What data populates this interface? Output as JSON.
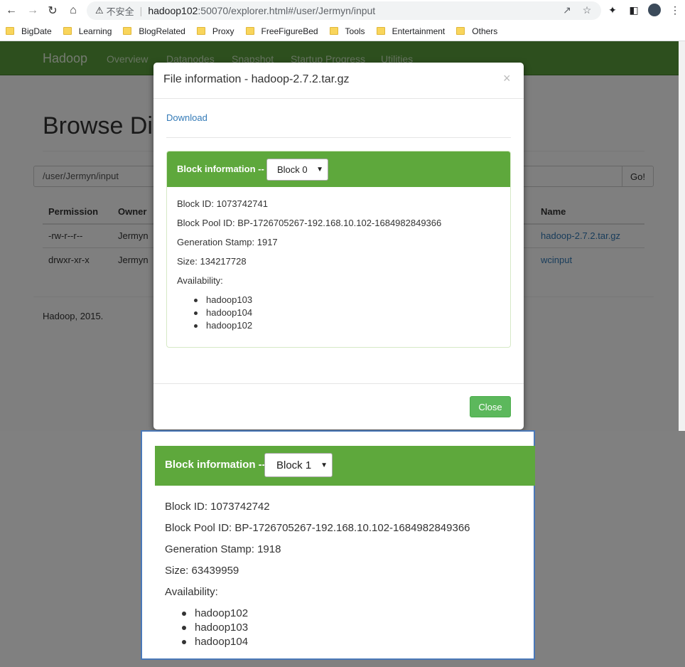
{
  "browser": {
    "warning_label": "不安全",
    "url_host": "hadoop102",
    "url_path": ":50070/explorer.html#/user/Jermyn/input",
    "bookmarks": [
      "BigDate",
      "Learning",
      "BlogRelated",
      "Proxy",
      "FreeFigureBed",
      "Tools",
      "Entertainment",
      "Others"
    ]
  },
  "navbar": {
    "brand": "Hadoop",
    "links": [
      "Overview",
      "Datanodes",
      "Snapshot",
      "Startup Progress",
      "Utilities"
    ]
  },
  "page": {
    "title": "Browse Directory",
    "path_value": "/user/Jermyn/input",
    "go_label": "Go!",
    "headers": [
      "Permission",
      "Owner",
      "Name"
    ],
    "rows": [
      {
        "permission": "-rw-r--r--",
        "owner": "Jermyn",
        "name": "hadoop-2.7.2.tar.gz"
      },
      {
        "permission": "drwxr-xr-x",
        "owner": "Jermyn",
        "name": "wcinput"
      }
    ],
    "footer": "Hadoop, 2015."
  },
  "modal": {
    "title": "File information - hadoop-2.7.2.tar.gz",
    "close_x": "×",
    "download_label": "Download",
    "block_label": "Block information --",
    "selected_block": "Block 0",
    "block_id": "Block ID: 1073742741",
    "pool_id": "Block Pool ID: BP-1726705267-192.168.10.102-1684982849366",
    "gen_stamp": "Generation Stamp: 1917",
    "size": "Size: 134217728",
    "availability_label": "Availability:",
    "availability": [
      "hadoop103",
      "hadoop104",
      "hadoop102"
    ],
    "close_label": "Close"
  },
  "zoom": {
    "block_label": "Block information --",
    "selected_block": "Block 1",
    "block_id": "Block ID: 1073742742",
    "pool_id": "Block Pool ID: BP-1726705267-192.168.10.102-1684982849366",
    "gen_stamp": "Generation Stamp: 1918",
    "size": "Size: 63439959",
    "availability_label": "Availability:",
    "availability": [
      "hadoop102",
      "hadoop103",
      "hadoop104"
    ]
  },
  "colors": {
    "navbar": "#5a9e3d",
    "panel_heading": "#5ea83c",
    "link": "#337ab7",
    "close_button": "#5cb85c"
  }
}
